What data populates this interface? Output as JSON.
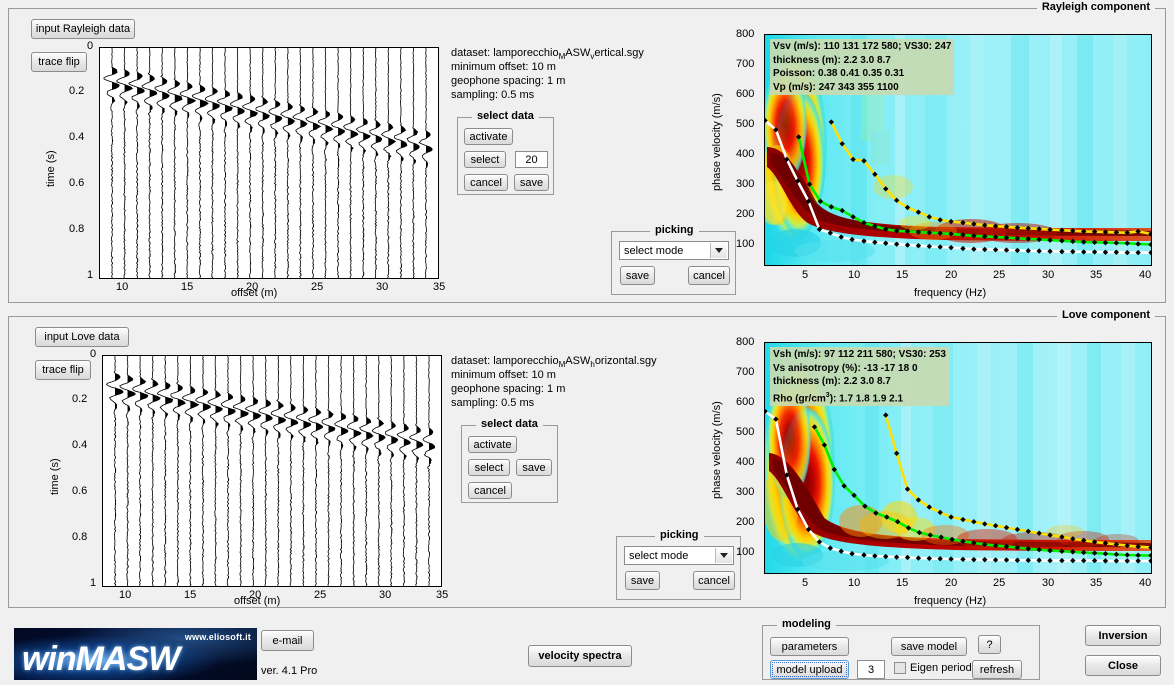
{
  "app": {
    "name": "winMASW",
    "version_label": "ver. 4.1 Pro",
    "website": "www.eliosoft.it",
    "logo_text": "winMASW"
  },
  "rayleigh": {
    "panel_title": "Rayleigh component",
    "input_button": "input Rayleigh data",
    "trace_flip_button": "trace flip",
    "info": {
      "dataset": "dataset: lamporecchio_MASW_vertical.sgy",
      "dataset_prefix": "dataset: lamporecchio",
      "dataset_mid": "ASW",
      "dataset_suffix": "ertical.sgy",
      "minimum_offset": "minimum offset: 10 m",
      "geophone_spacing": "geophone spacing: 1 m",
      "sampling": "sampling: 0.5 ms"
    },
    "select_data": {
      "title": "select data",
      "activate": "activate",
      "select": "select",
      "cancel": "cancel",
      "save": "save",
      "value": "20"
    },
    "picking": {
      "title": "picking",
      "mode_value": "select mode",
      "save": "save",
      "cancel": "cancel"
    },
    "seismogram": {
      "xlabel": "offset (m)",
      "ylabel": "time (s)",
      "xticks": [
        "10",
        "15",
        "20",
        "25",
        "30",
        "35"
      ],
      "yticks": [
        "0",
        "0.2",
        "0.4",
        "0.6",
        "0.8",
        "1"
      ],
      "xlim": [
        9,
        35
      ],
      "ylim": [
        0,
        1
      ]
    },
    "spectrum": {
      "xlabel": "frequency (Hz)",
      "ylabel": "phase velocity (m/s)",
      "xticks": [
        "5",
        "10",
        "15",
        "20",
        "25",
        "30",
        "35",
        "40"
      ],
      "yticks": [
        "100",
        "200",
        "300",
        "400",
        "500",
        "600",
        "700",
        "800"
      ],
      "xlim": [
        1,
        40
      ],
      "ylim": [
        60,
        800
      ]
    },
    "model_box": {
      "line1_label": "Vsv (m/s):",
      "line1_values": "110  131  172  580; VS30: 247",
      "line2_label": "thickness (m):",
      "line2_values": "2.2     3.0     8.7",
      "line3_label": "Poisson:",
      "line3_values": "0.38  0.41  0.35  0.31",
      "line4_label": "Vp (m/s):",
      "line4_values": "247   343   355  1100"
    }
  },
  "love": {
    "panel_title": "Love component",
    "input_button": "input Love data",
    "trace_flip_button": "trace flip",
    "info": {
      "dataset": "dataset: lamporecchio_MASW_horizontal.sgy",
      "dataset_prefix": "dataset: lamporecchio",
      "dataset_mid": "ASW",
      "dataset_suffix": "orizontal.sgy",
      "minimum_offset": "minimum offset: 10 m",
      "geophone_spacing": "geophone spacing: 1 m",
      "sampling": "sampling: 0.5 ms"
    },
    "select_data": {
      "title": "select data",
      "activate": "activate",
      "select": "select",
      "save": "save",
      "cancel": "cancel"
    },
    "picking": {
      "title": "picking",
      "mode_value": "select mode",
      "save": "save",
      "cancel": "cancel"
    },
    "seismogram": {
      "xlabel": "offset (m)",
      "ylabel": "time (s)",
      "xticks": [
        "10",
        "15",
        "20",
        "25",
        "30",
        "35"
      ],
      "yticks": [
        "0",
        "0.2",
        "0.4",
        "0.6",
        "0.8",
        "1"
      ],
      "xlim": [
        9,
        35
      ],
      "ylim": [
        0,
        1
      ]
    },
    "spectrum": {
      "xlabel": "frequency (Hz)",
      "ylabel": "phase velocity (m/s)",
      "xticks": [
        "5",
        "10",
        "15",
        "20",
        "25",
        "30",
        "35",
        "40"
      ],
      "yticks": [
        "100",
        "200",
        "300",
        "400",
        "500",
        "600",
        "700",
        "800"
      ],
      "xlim": [
        1,
        40
      ],
      "ylim": [
        60,
        800
      ]
    },
    "model_box": {
      "line1_label": "Vsh (m/s):",
      "line1_values": "97  112  211  580; VS30: 253",
      "line2_label": "Vs anisotropy (%):",
      "line2_values": "-13 -17  18    0",
      "line3_label": "thickness (m):",
      "line3_values": "2.2     3.0     8.7",
      "line4_label": "Rho (gr/cm",
      "line4_sup": "3",
      "line4_values": "): 1.7   1.8   1.9   2.1"
    }
  },
  "bottom": {
    "email_button": "e-mail",
    "velocity_spectra_button": "velocity spectra",
    "modeling": {
      "title": "modeling",
      "parameters": "parameters",
      "save_model": "save model",
      "help": "?",
      "model_upload": "model upload",
      "model_number": "3",
      "eigen_period": "Eigen period",
      "refresh": "refresh"
    },
    "inversion_button": "Inversion",
    "close_button": "Close"
  },
  "colors": {
    "background": "#f0f0f0",
    "panel_border": "#9a9a9a",
    "info_box_bg": "#c6dab2",
    "curve_fundamental": "#ffffff",
    "curve_first": "#00ee00",
    "curve_second": "#ffe000",
    "marker": "#000000"
  },
  "chart_data": [
    {
      "type": "line",
      "name": "rayleigh-dispersion-spectrum",
      "title": "Rayleigh component phase velocity spectrum",
      "xlabel": "frequency (Hz)",
      "ylabel": "phase velocity (m/s)",
      "xlim": [
        1,
        40
      ],
      "ylim": [
        60,
        800
      ],
      "xticks": [
        5,
        10,
        15,
        20,
        25,
        30,
        35,
        40
      ],
      "yticks": [
        100,
        200,
        300,
        400,
        500,
        600,
        700,
        800
      ],
      "series": [
        {
          "name": "fundamental mode (white)",
          "color": "#ffffff",
          "x": [
            1.0,
            2.1,
            3.2,
            4.3,
            5.4,
            6.5,
            7.6,
            8.7,
            9.8,
            11.0,
            12.1,
            13.2,
            14.3,
            15.4,
            16.5,
            17.6,
            18.7,
            19.8,
            21.0,
            22.1,
            23.2,
            24.3,
            25.4,
            26.5,
            27.6,
            28.7,
            29.8,
            31.0,
            32.1,
            33.2,
            34.3,
            35.4,
            36.5,
            37.6,
            38.7,
            40.0
          ],
          "y": [
            525,
            495,
            400,
            330,
            265,
            175,
            163,
            150,
            142,
            137,
            133,
            130,
            127,
            124,
            122,
            120,
            118,
            116,
            113,
            111,
            110,
            109,
            108,
            107,
            106,
            105,
            104,
            103,
            103,
            102,
            102,
            101,
            101,
            100,
            100,
            100
          ]
        },
        {
          "name": "first higher mode (green)",
          "color": "#00ee00",
          "x": [
            4.4,
            5.5,
            6.6,
            7.7,
            8.8,
            9.9,
            11.0,
            12.1,
            13.2,
            14.3,
            15.4,
            16.5,
            17.6,
            18.7,
            19.8,
            21.0,
            22.1,
            23.2,
            24.3,
            25.4,
            26.5,
            27.6,
            28.7,
            29.8,
            31.0,
            32.1,
            33.2,
            34.3,
            35.4,
            36.5,
            37.6,
            38.7,
            40.0
          ],
          "y": [
            472,
            320,
            265,
            247,
            235,
            215,
            196,
            185,
            175,
            170,
            168,
            166,
            164,
            162,
            160,
            157,
            154,
            152,
            150,
            148,
            146,
            144,
            142,
            140,
            138,
            136,
            134,
            133,
            132,
            131,
            130,
            128,
            126
          ]
        },
        {
          "name": "second higher mode (yellow)",
          "color": "#ffe000",
          "x": [
            7.7,
            8.8,
            9.9,
            11.0,
            12.1,
            13.2,
            14.3,
            15.4,
            16.5,
            17.6,
            18.7,
            19.8,
            21.0,
            22.1,
            23.2,
            24.3,
            25.4,
            26.5,
            27.6,
            28.7,
            29.8,
            31.0,
            32.1,
            33.2,
            34.3,
            35.4,
            36.5,
            37.6,
            38.7,
            40.0
          ],
          "y": [
            520,
            450,
            400,
            395,
            352,
            305,
            268,
            245,
            230,
            215,
            205,
            200,
            196,
            192,
            188,
            185,
            183,
            180,
            178,
            176,
            174,
            172,
            170,
            168,
            167,
            166,
            165,
            164,
            168,
            160
          ]
        }
      ]
    },
    {
      "type": "line",
      "name": "love-dispersion-spectrum",
      "title": "Love component phase velocity spectrum",
      "xlabel": "frequency (Hz)",
      "ylabel": "phase velocity (m/s)",
      "xlim": [
        1,
        40
      ],
      "ylim": [
        60,
        800
      ],
      "xticks": [
        5,
        10,
        15,
        20,
        25,
        30,
        35,
        40
      ],
      "yticks": [
        100,
        200,
        300,
        400,
        500,
        600,
        700,
        800
      ],
      "series": [
        {
          "name": "fundamental mode (white)",
          "color": "#ffffff",
          "x": [
            1.0,
            2.1,
            3.2,
            4.3,
            5.4,
            6.5,
            7.6,
            8.7,
            9.8,
            11.0,
            12.1,
            13.2,
            14.3,
            15.4,
            16.5,
            17.6,
            18.7,
            19.8,
            21.0,
            22.1,
            23.2,
            24.3,
            25.4,
            26.5,
            27.6,
            28.7,
            29.8,
            31.0,
            32.1,
            33.2,
            34.3,
            35.4,
            36.5,
            37.6,
            38.7,
            40.0
          ],
          "y": [
            580,
            555,
            375,
            265,
            200,
            160,
            140,
            130,
            122,
            118,
            115,
            113,
            111,
            110,
            108,
            107,
            106,
            105,
            104,
            103,
            103,
            102,
            102,
            101,
            101,
            101,
            100,
            100,
            100,
            100,
            100,
            99,
            99,
            99,
            99,
            99
          ]
        },
        {
          "name": "first higher mode (green)",
          "color": "#00ee00",
          "x": [
            6.0,
            7.0,
            8.0,
            9.0,
            10.0,
            11.1,
            12.2,
            13.3,
            14.4,
            15.5,
            16.6,
            17.7,
            18.8,
            19.9,
            21.0,
            22.1,
            23.2,
            24.3,
            25.4,
            26.5,
            27.6,
            28.7,
            29.8,
            31.0,
            32.1,
            33.2,
            34.3,
            35.4,
            36.5,
            37.6,
            38.7,
            40.0
          ],
          "y": [
            530,
            472,
            393,
            340,
            310,
            275,
            253,
            240,
            225,
            205,
            190,
            182,
            175,
            168,
            162,
            157,
            152,
            148,
            145,
            142,
            138,
            135,
            132,
            130,
            128,
            126,
            124,
            122,
            120,
            118,
            117,
            116
          ]
        },
        {
          "name": "second higher mode (yellow)",
          "color": "#ffe000",
          "x": [
            13.2,
            14.3,
            15.4,
            16.5,
            17.6,
            18.7,
            19.8,
            21.0,
            22.1,
            23.2,
            24.3,
            25.4,
            26.5,
            27.6,
            28.7,
            29.8,
            31.0,
            32.1,
            33.2,
            34.3,
            35.4,
            36.5,
            37.6,
            38.7,
            40.0
          ],
          "y": [
            568,
            445,
            330,
            295,
            272,
            255,
            240,
            232,
            225,
            218,
            212,
            206,
            200,
            194,
            188,
            182,
            176,
            170,
            165,
            160,
            156,
            152,
            148,
            145,
            142
          ]
        }
      ]
    }
  ]
}
